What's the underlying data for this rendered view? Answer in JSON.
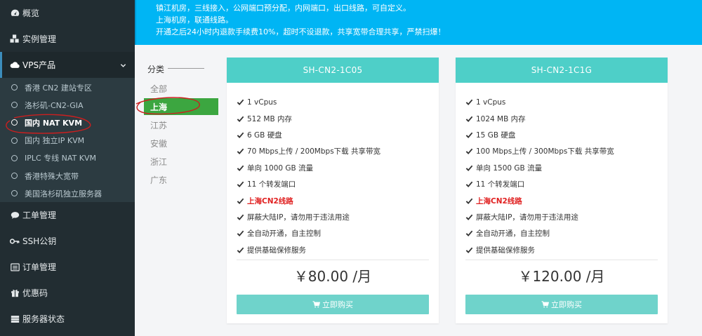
{
  "sidebar": {
    "items_top": [
      {
        "label": "概览",
        "icon": "dashboard-icon"
      },
      {
        "label": "实例管理",
        "icon": "cubes-icon"
      }
    ],
    "vps": {
      "label": "VPS产品",
      "icon": "cloud-icon"
    },
    "submenu": [
      {
        "label": "香港 CN2 建站专区",
        "active": false
      },
      {
        "label": "洛杉矶-CN2-GIA",
        "active": false
      },
      {
        "label": "国内 NAT KVM",
        "active": true
      },
      {
        "label": "国内 独立IP KVM",
        "active": false
      },
      {
        "label": "IPLC 专线 NAT KVM",
        "active": false
      },
      {
        "label": "香港特殊大宽带",
        "active": false
      },
      {
        "label": "美国洛杉矶独立服务器",
        "active": false
      }
    ],
    "items_bottom": [
      {
        "label": "工单管理",
        "icon": "comment-icon"
      },
      {
        "label": "SSH公钥",
        "icon": "key-icon"
      },
      {
        "label": "订单管理",
        "icon": "list-icon"
      },
      {
        "label": "优惠码",
        "icon": "gift-icon"
      },
      {
        "label": "服务器状态",
        "icon": "server-icon"
      }
    ]
  },
  "banner": {
    "lines": [
      "镇江机房，三线接入，公网端口预分配，内网端口，出口线路，可自定义。",
      "上海机房，联通线路。",
      "开通之后24小时内退款手续费10%，超时不设退款，共享宽带合理共享，严禁扫爆！"
    ]
  },
  "categories": {
    "title": "分类",
    "items": [
      {
        "label": "全部",
        "active": false
      },
      {
        "label": "上海",
        "active": true
      },
      {
        "label": "江苏",
        "active": false
      },
      {
        "label": "安徽",
        "active": false
      },
      {
        "label": "浙江",
        "active": false
      },
      {
        "label": "广东",
        "active": false
      }
    ]
  },
  "products": [
    {
      "name": "SH-CN2-1C05",
      "features": [
        {
          "text": "1 vCpus",
          "highlight": false
        },
        {
          "text": "512 MB 内存",
          "highlight": false
        },
        {
          "text": "6 GB 硬盘",
          "highlight": false
        },
        {
          "text": "70 Mbps上传 / 200Mbps下载 共享带宽",
          "highlight": false
        },
        {
          "text": "单向 1000 GB 流量",
          "highlight": false
        },
        {
          "text": "11 个转发端口",
          "highlight": false
        },
        {
          "text": "上海CN2线路",
          "highlight": true
        },
        {
          "text": "屏蔽大陆IP，请勿用于违法用途",
          "highlight": false
        },
        {
          "text": "全自动开通，自主控制",
          "highlight": false
        },
        {
          "text": "提供基础保修服务",
          "highlight": false
        }
      ],
      "price": "￥80.00 /月",
      "buy_label": "立即购买"
    },
    {
      "name": "SH-CN2-1C1G",
      "features": [
        {
          "text": "1 vCpus",
          "highlight": false
        },
        {
          "text": "1024 MB 内存",
          "highlight": false
        },
        {
          "text": "15 GB 硬盘",
          "highlight": false
        },
        {
          "text": "100 Mbps上传 / 300Mbps下载 共享带宽",
          "highlight": false
        },
        {
          "text": "单向 1500 GB 流量",
          "highlight": false
        },
        {
          "text": "11 个转发端口",
          "highlight": false
        },
        {
          "text": "上海CN2线路",
          "highlight": true
        },
        {
          "text": "屏蔽大陆IP，请勿用于违法用途",
          "highlight": false
        },
        {
          "text": "全自动开通，自主控制",
          "highlight": false
        },
        {
          "text": "提供基础保修服务",
          "highlight": false
        }
      ],
      "price": "￥120.00 /月",
      "buy_label": "立即购买"
    }
  ],
  "colors": {
    "sidebar_bg": "#222d32",
    "banner_bg": "#00b5f4",
    "card_header": "#4ecfc8",
    "buy_button": "#6fd3cb",
    "category_active": "#3ca640",
    "highlight_text": "#e02020",
    "annotation_red": "#cc1f1f"
  }
}
